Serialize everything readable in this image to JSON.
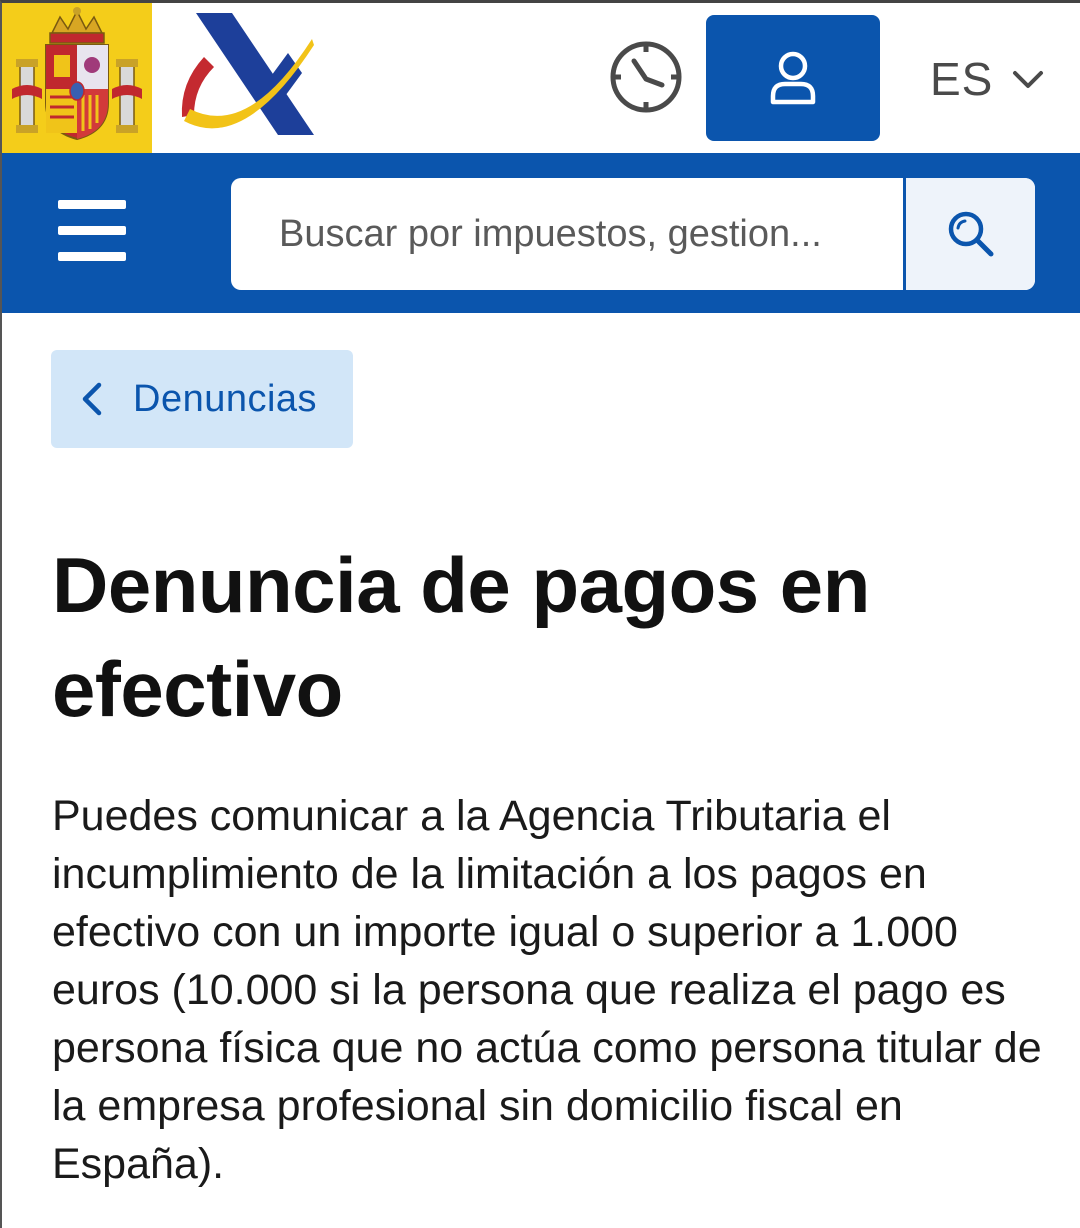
{
  "header": {
    "emblem_icon": "coat-of-arms-spain",
    "logo_icon": "agencia-tributaria-logo",
    "history_icon": "clock-icon",
    "user_icon": "user-icon",
    "language": "ES",
    "language_icon": "chevron-down-icon",
    "accent_color": "#0b55ad"
  },
  "search": {
    "menu_icon": "hamburger-menu-icon",
    "placeholder": "Buscar por impuestos, gestion...",
    "value": "",
    "button_icon": "search-icon"
  },
  "back": {
    "label": "Denuncias",
    "icon": "chevron-left-icon"
  },
  "content": {
    "title": "Denuncia de pagos en efectivo",
    "body": "Puedes comunicar a la Agencia Tributaria el incumplimiento de la limitación a los pagos en efectivo con un importe igual o superior a 1.000 euros (10.000 si la persona que realiza el pago es persona física que no actúa como persona titular de la empresa profesional sin domicilio fiscal en España)."
  }
}
